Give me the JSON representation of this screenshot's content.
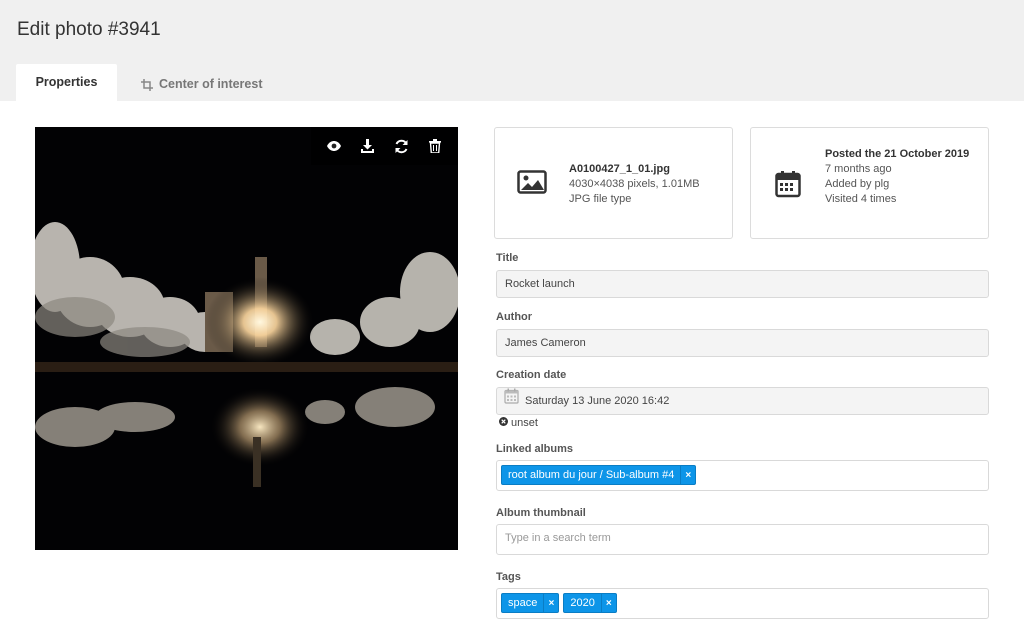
{
  "header": {
    "title": "Edit photo #3941"
  },
  "tabs": [
    {
      "label": "Properties",
      "active": true
    },
    {
      "label": "Center of interest",
      "icon": "crop-icon"
    }
  ],
  "photo": {
    "alt": "Rocket launch at night",
    "toolbar": [
      "eye-icon",
      "download-icon",
      "refresh-icon",
      "trash-icon"
    ]
  },
  "file_card": {
    "icon": "image-icon",
    "filename": "A0100427_1_01.jpg",
    "dimensions": "4030×4038 pixels, 1.01MB",
    "filetype": "JPG file type"
  },
  "date_card": {
    "icon": "calendar-icon",
    "posted": "Posted the 21 October 2019",
    "ago": "7 months ago",
    "added_by": "Added by plg",
    "visits": "Visited 4 times"
  },
  "form": {
    "title_label": "Title",
    "title_value": "Rocket launch",
    "author_label": "Author",
    "author_value": "James Cameron",
    "creation_label": "Creation date",
    "creation_value": "Saturday 13 June 2020 16:42",
    "unset_label": "unset",
    "albums_label": "Linked albums",
    "albums": [
      "root album du jour / Sub-album #4"
    ],
    "thumb_label": "Album thumbnail",
    "thumb_placeholder": "Type in a search term",
    "tags_label": "Tags",
    "tags": [
      "space",
      "2020"
    ]
  },
  "colors": {
    "accent": "#0d95e8",
    "topbar": "#f0f0f0"
  }
}
